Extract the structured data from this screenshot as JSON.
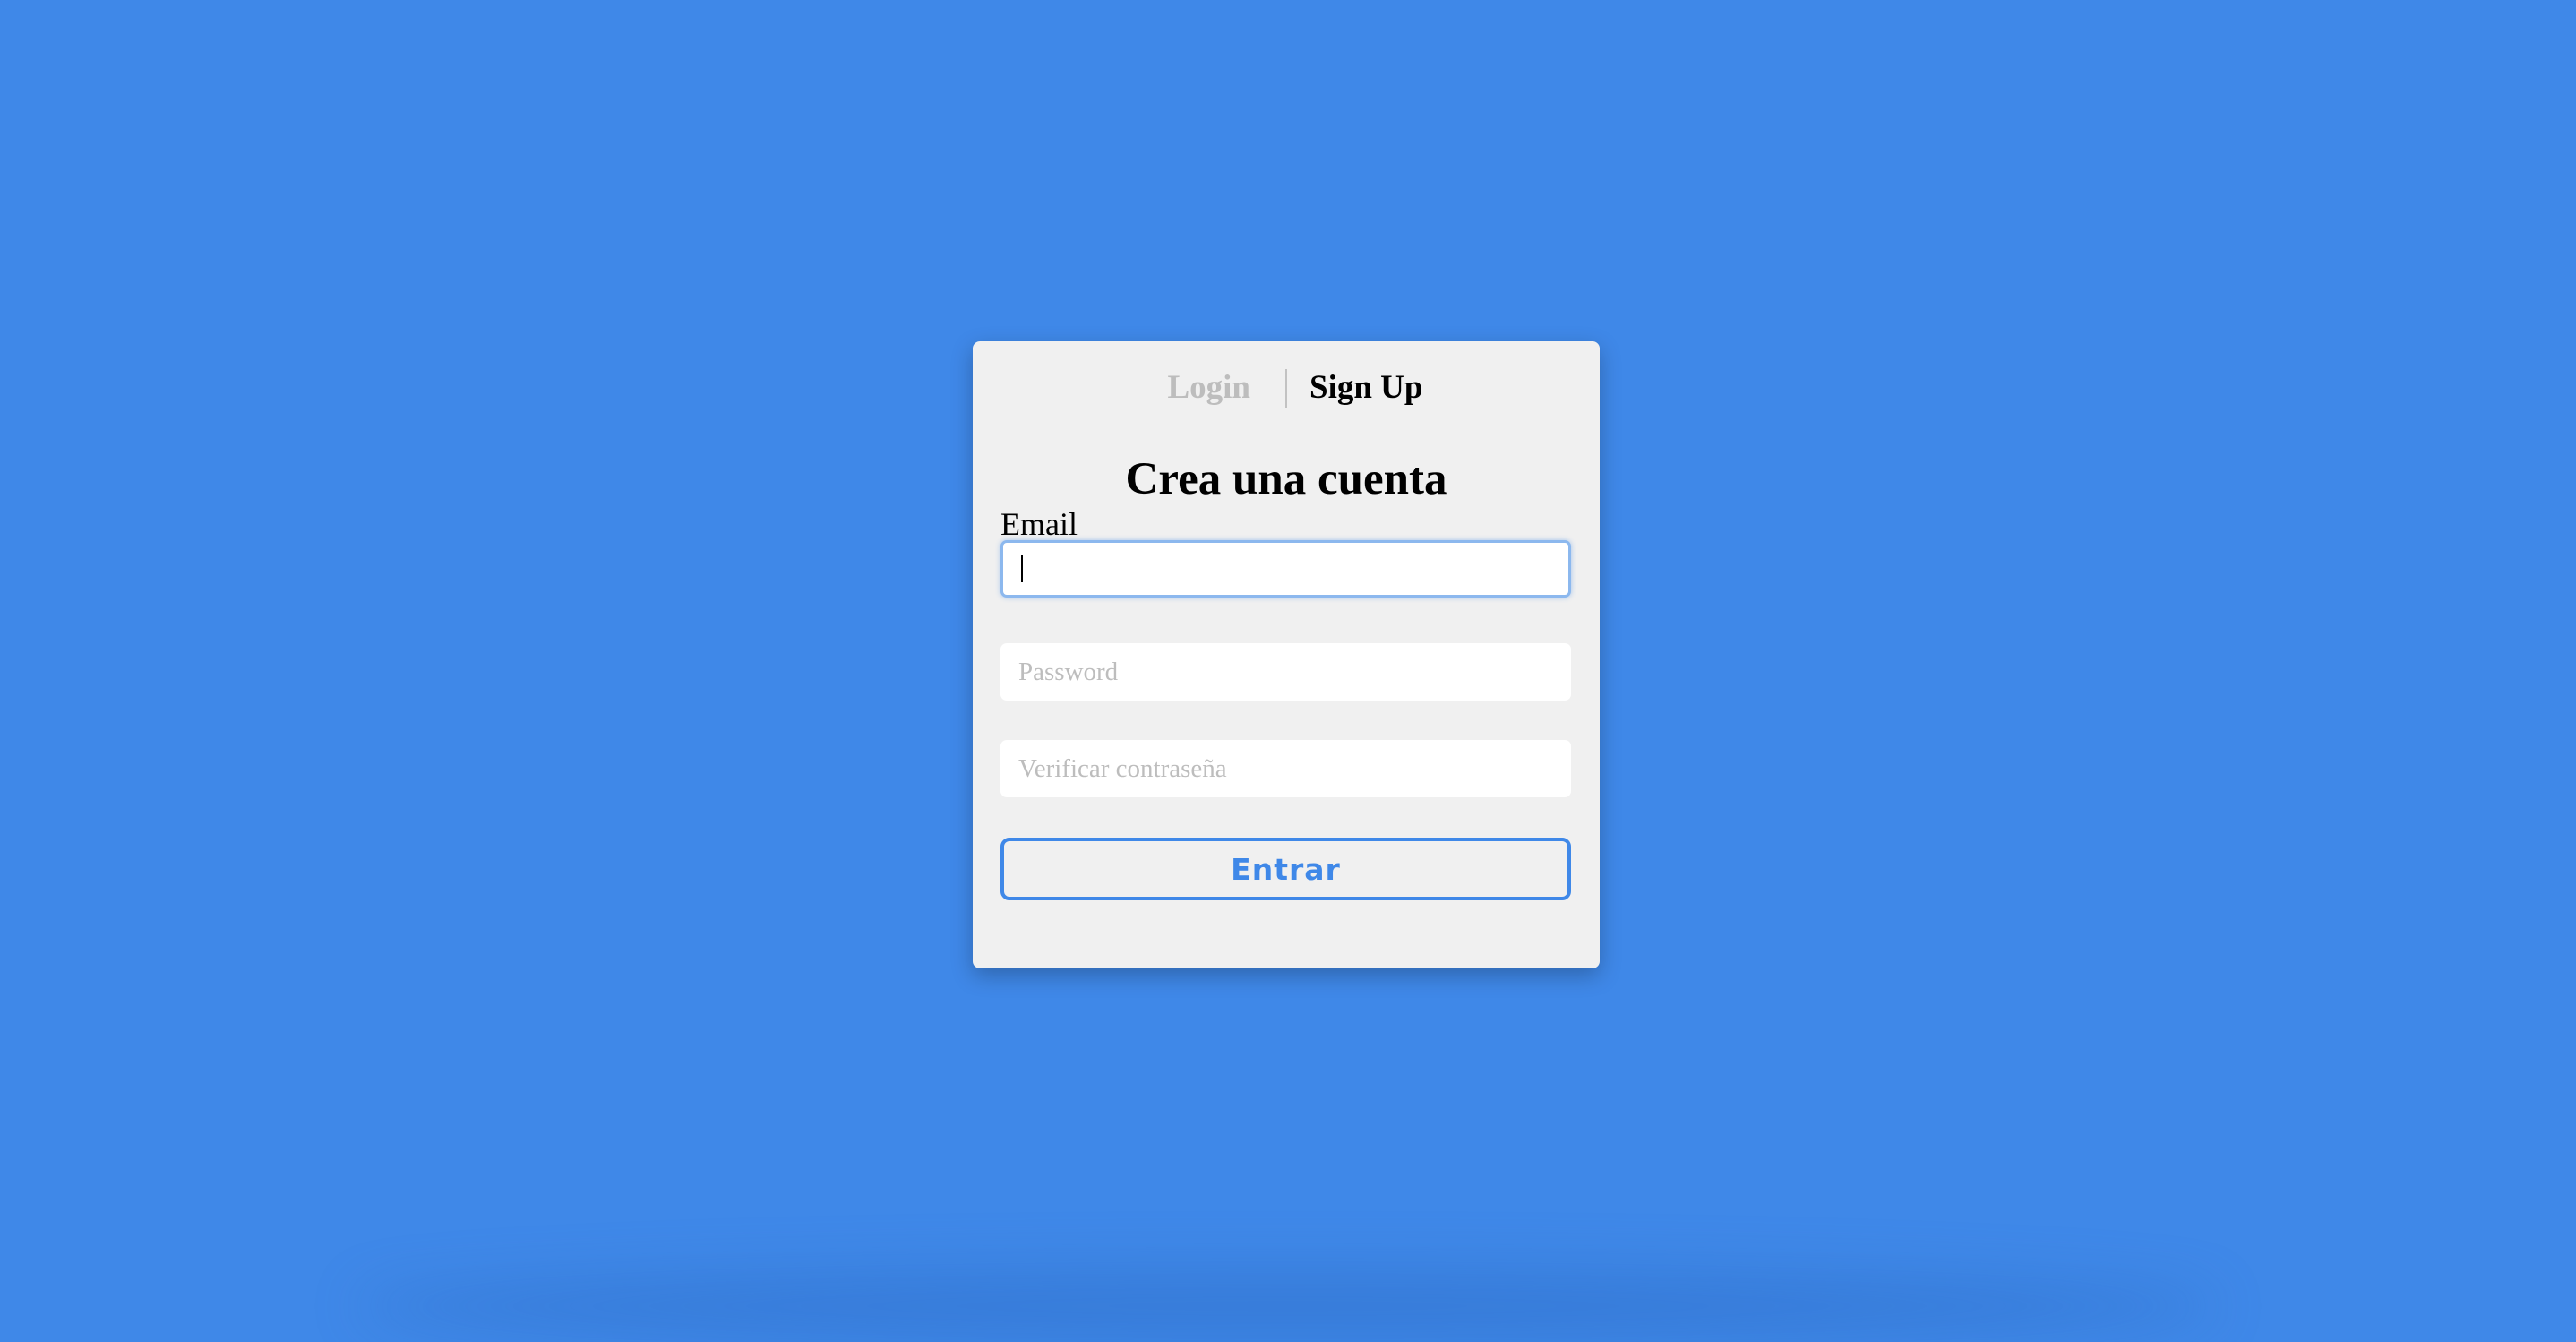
{
  "tabs": {
    "login": "Login",
    "signup": "Sign Up"
  },
  "form": {
    "title": "Crea una cuenta",
    "email_label": "Email",
    "email_value": "",
    "password_placeholder": "Password",
    "verify_placeholder": "Verificar contraseña",
    "submit_label": "Entrar"
  },
  "colors": {
    "background": "#3f88e8",
    "card": "#f0f0f0",
    "accent": "#3f88e8",
    "inactive_tab": "#bdbdbd"
  }
}
